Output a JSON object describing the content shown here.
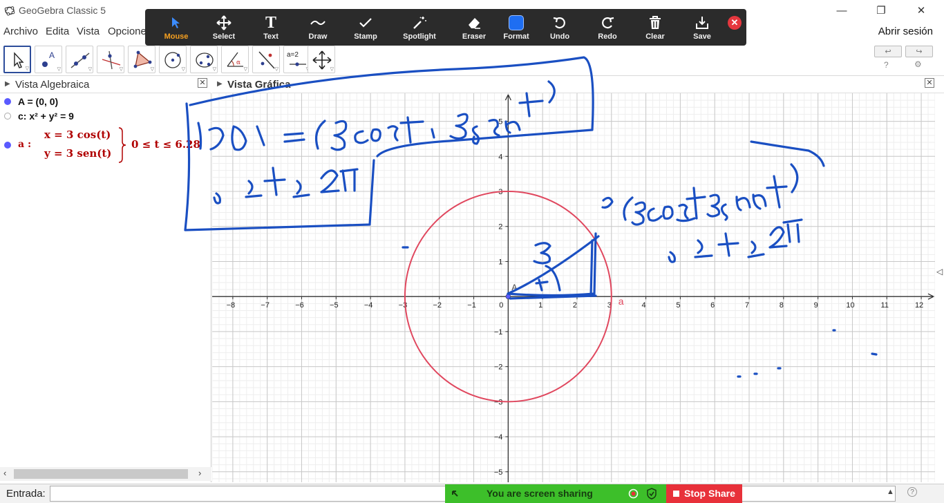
{
  "window": {
    "title": "GeoGebra Classic 5",
    "minimize": "—",
    "maximize": "❐",
    "close": "✕"
  },
  "menu": {
    "items": [
      "Archivo",
      "Edita",
      "Vista",
      "Opcione"
    ],
    "login": "Abrir sesión"
  },
  "zoom_toolbar": {
    "items": [
      {
        "label": "Mouse",
        "icon": "pointer-icon"
      },
      {
        "label": "Select",
        "icon": "move-icon"
      },
      {
        "label": "Text",
        "icon": "text-icon"
      },
      {
        "label": "Draw",
        "icon": "draw-icon"
      },
      {
        "label": "Stamp",
        "icon": "checkmark-icon"
      },
      {
        "label": "Spotlight",
        "icon": "spotlight-icon"
      },
      {
        "label": "Eraser",
        "icon": "eraser-icon"
      },
      {
        "label": "Format",
        "icon": "format-icon"
      },
      {
        "label": "Undo",
        "icon": "undo-icon"
      },
      {
        "label": "Redo",
        "icon": "redo-icon"
      },
      {
        "label": "Clear",
        "icon": "trash-icon"
      },
      {
        "label": "Save",
        "icon": "save-icon"
      }
    ],
    "active": "Mouse",
    "accent": "#f6a020",
    "format_color": "#1e6ef2",
    "close_color": "#e5373e"
  },
  "tools": {
    "items": [
      "move-tool",
      "point-tool",
      "line-tool",
      "perpendicular-tool",
      "polygon-tool",
      "circle-tool",
      "conic-tool",
      "angle-tool",
      "reflect-tool",
      "slider-tool",
      "move-view-tool"
    ],
    "slider_label": "a=2"
  },
  "algebra": {
    "title": "Vista Algebraica",
    "close": "✕",
    "items": [
      {
        "text": "A = (0, 0)",
        "visible": true
      },
      {
        "text": "c: x² + y² = 9",
        "visible": false
      }
    ],
    "curve": {
      "name": "a :",
      "x_eq": "x = 3 cos(t)",
      "y_eq": "y = 3 sen(t)",
      "range": "0 ≤ t ≤ 6.28"
    },
    "point_color": "#5a5aff"
  },
  "graphics": {
    "title": "Vista Gráfica",
    "close": "✕",
    "point_label": "A",
    "curve_label": "a",
    "circle_color": "#e0475e",
    "ink_color": "#1a4fc2"
  },
  "chart_data": {
    "type": "scatter",
    "xlim": [
      -8.6,
      12.4
    ],
    "ylim": [
      -5.3,
      5.8
    ],
    "x_ticks": [
      -8,
      -7,
      -6,
      -5,
      -4,
      -3,
      -2,
      -1,
      0,
      1,
      2,
      3,
      4,
      5,
      6,
      7,
      8,
      9,
      10,
      11,
      12
    ],
    "y_ticks": [
      -5,
      -4,
      -3,
      -2,
      -1,
      1,
      2,
      3,
      4,
      5
    ],
    "grid": true,
    "circle": {
      "cx": 0,
      "cy": 0,
      "r": 3
    }
  },
  "input": {
    "label": "Entrada:"
  },
  "share": {
    "message": "You are screen sharing",
    "stop": "Stop Share"
  }
}
